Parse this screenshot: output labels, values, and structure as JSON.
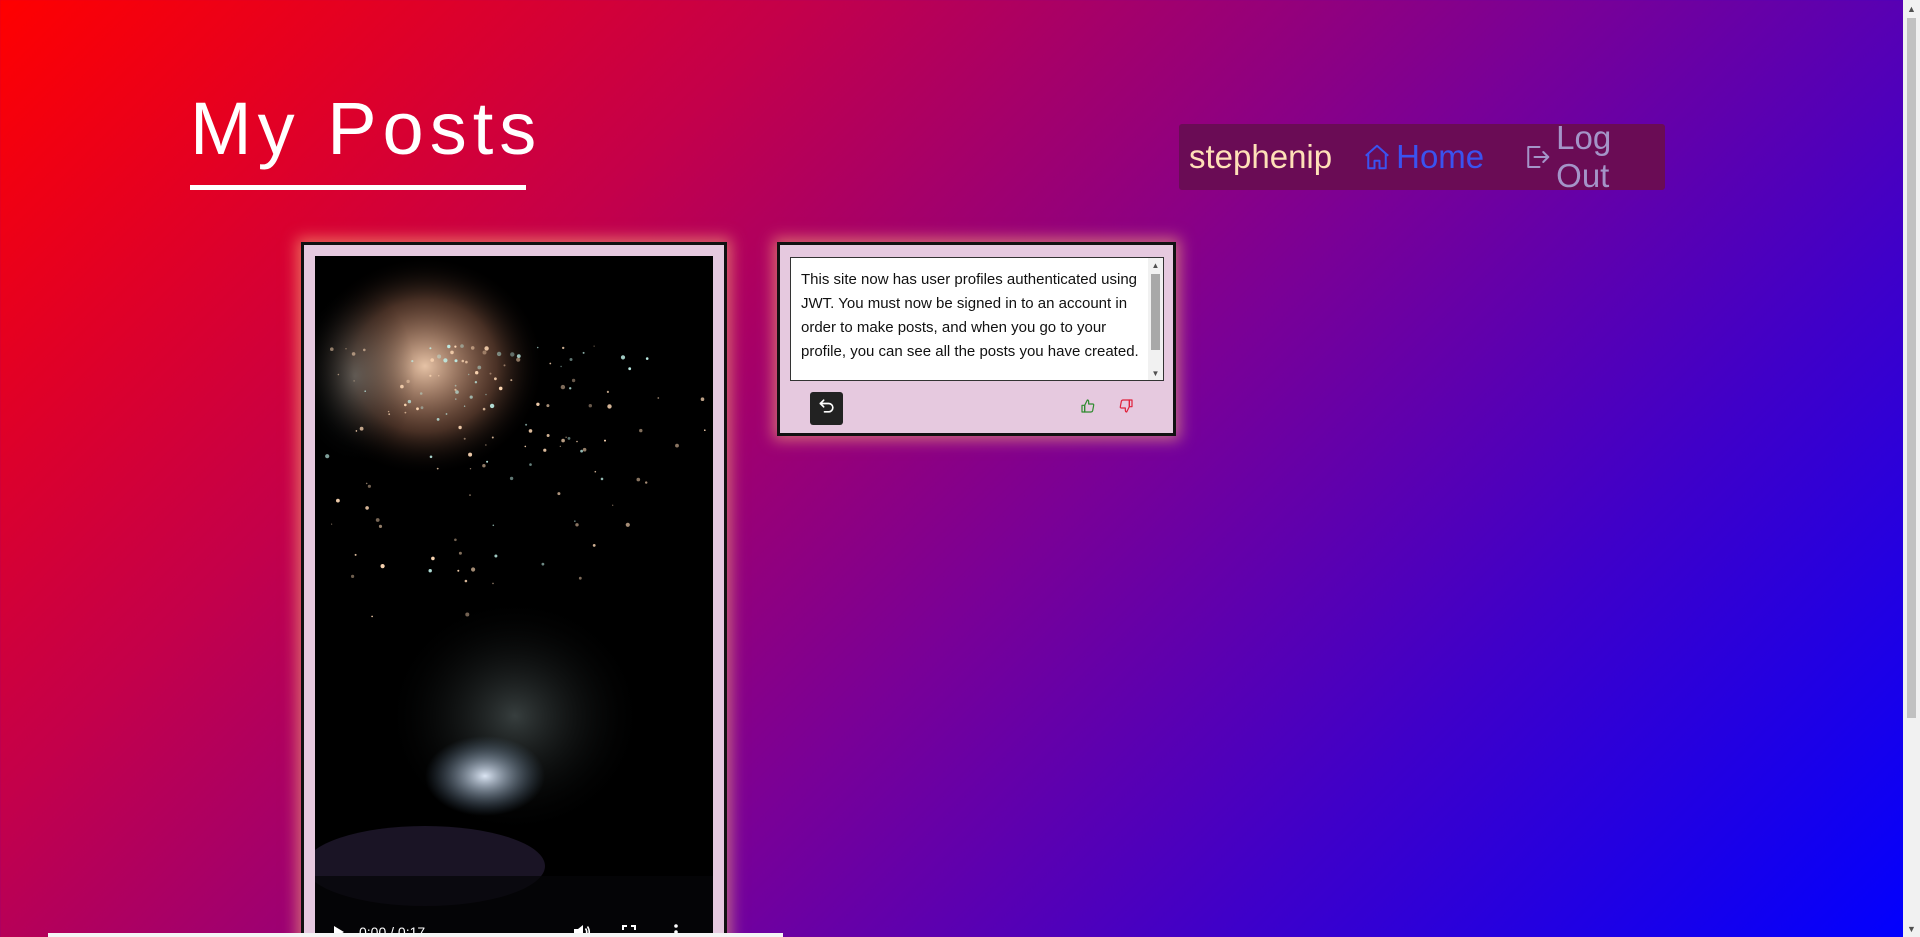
{
  "page": {
    "title": "My Posts",
    "background_colors": [
      "#ff0000",
      "#c4004a",
      "#7a0096",
      "#4000c8",
      "#0000ff"
    ]
  },
  "nav": {
    "username": "stephenip",
    "home_label": "Home",
    "logout_label": "Log Out",
    "home_icon": "home-icon",
    "logout_icon": "logout-icon",
    "colors": {
      "background": "#6a0c55",
      "username": "#ffe0b8",
      "home": "#3a53f0",
      "logout": "#a494c8"
    }
  },
  "video_post": {
    "current_time": "0:00",
    "duration": "0:17",
    "time_display": "0:00 / 0:17",
    "controls": [
      "play-icon",
      "volume-icon",
      "fullscreen-icon",
      "more-options-icon"
    ]
  },
  "text_post": {
    "content": "This site now has user profiles authenticated using JWT. You must now be signed in to an account in order to make posts, and when you go to your profile, you can see all the posts you have created.",
    "actions": [
      "undo-icon",
      "thumbs-up-icon",
      "thumbs-down-icon"
    ],
    "colors": {
      "like": "#2e8b2e",
      "dislike": "#e0203a",
      "card": "#e6c9df"
    }
  }
}
